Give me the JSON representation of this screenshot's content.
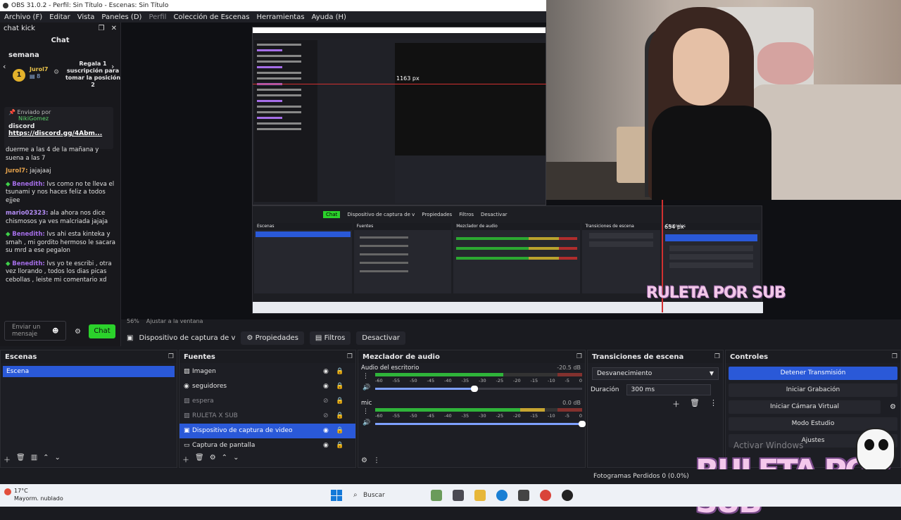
{
  "window": {
    "title": "OBS 31.0.2 - Perfil: Sin Título - Escenas: Sin Título"
  },
  "menu": [
    "Archivo (F)",
    "Editar",
    "Vista",
    "Paneles (D)",
    "Perfil",
    "Colección de Escenas",
    "Herramientas",
    "Ayuda (H)"
  ],
  "chat": {
    "dock_title": "chat kick",
    "title": "Chat",
    "semana": "semana",
    "reward_user": "Jurol7",
    "reward_count": "8",
    "reward_text": "Regala 1 suscripción para tomar la posición 2",
    "pinned_label": "Enviado por",
    "pinned_user": "NikiGomez",
    "pinned_word": "discord",
    "pinned_link": "https://discord.gg/4Abm...",
    "messages": [
      {
        "user": "",
        "text": "duerme a las 4 de la mañana y suena a las 7",
        "cls": ""
      },
      {
        "user": "Jurol7:",
        "text": " jajajaaj",
        "cls": "u1"
      },
      {
        "user": "Benedith:",
        "text": " lvs como no te lleva el tsunami y nos haces feliz a todos ejjee",
        "cls": "u2",
        "gem": true
      },
      {
        "user": "mario02323:",
        "text": " ala ahora nos dice chismosos ya ves malcriada jajaja",
        "cls": "u3"
      },
      {
        "user": "Benedith:",
        "text": " lvs ahi esta kinteka y smah , mi gordito hermoso le sacara su mrd a ese pegalon",
        "cls": "u2",
        "gem": true
      },
      {
        "user": "Benedith:",
        "text": " lvs yo te escribi , otra vez llorando , todos los dias picas cebollas , leiste mi comentario xd",
        "cls": "u2",
        "gem": true
      }
    ],
    "input_placeholder": "Enviar un mensaje",
    "send_label": "Chat"
  },
  "preview": {
    "zoom": "56%",
    "fit": "Ajustar a la ventana",
    "px_label": "654 px",
    "overlay": "RULETA POR SUB",
    "nested_px": "1163 px"
  },
  "source_toolbar": {
    "source": "Dispositivo de captura de v",
    "props": "Propiedades",
    "filters": "Filtros",
    "deactivate": "Desactivar"
  },
  "escenas": {
    "title": "Escenas",
    "items": [
      "Escena"
    ]
  },
  "fuentes": {
    "title": "Fuentes",
    "items": [
      {
        "label": "Imagen",
        "icon": "image-icon",
        "visible": true
      },
      {
        "label": "seguidores",
        "icon": "browser-icon",
        "visible": true
      },
      {
        "label": "espera",
        "icon": "image-icon",
        "visible": false
      },
      {
        "label": "RULETA X SUB",
        "icon": "image-icon",
        "visible": false
      },
      {
        "label": "Dispositivo de captura de video",
        "icon": "camera-icon",
        "visible": true,
        "selected": true
      },
      {
        "label": "Captura de pantalla",
        "icon": "monitor-icon",
        "visible": true
      }
    ]
  },
  "mezclador": {
    "title": "Mezclador de audio",
    "channels": [
      {
        "name": "Audio del escritorio",
        "db": "-20.5 dB",
        "level": 0.62,
        "volume": 0.48
      },
      {
        "name": "mic",
        "db": "0.0 dB",
        "level": 0.82,
        "volume": 1.0
      }
    ],
    "scale": [
      "-60",
      "-55",
      "-50",
      "-45",
      "-40",
      "-35",
      "-30",
      "-25",
      "-20",
      "-15",
      "-10",
      "-5",
      "0"
    ]
  },
  "transiciones": {
    "title": "Transiciones de escena",
    "selected": "Desvanecimiento",
    "duration_label": "Duración",
    "duration_value": "300 ms"
  },
  "controles": {
    "title": "Controles",
    "buttons": [
      "Detener Transmisión",
      "Iniciar Grabación",
      "Iniciar Cámara Virtual",
      "Modo Estudio",
      "Ajustes"
    ]
  },
  "watermark": {
    "activate": "Activar Windows",
    "overlay": "RULETA POR SUB"
  },
  "status": {
    "frames": "Fotogramas Perdidos 0 (0.0%)"
  },
  "taskbar": {
    "temp": "17°C",
    "weather": "Mayorm. nublado",
    "search": "Buscar"
  },
  "colors": {
    "accent": "#2a59d8",
    "kick_green": "#2bd22b",
    "bg": "#1d1e24"
  }
}
